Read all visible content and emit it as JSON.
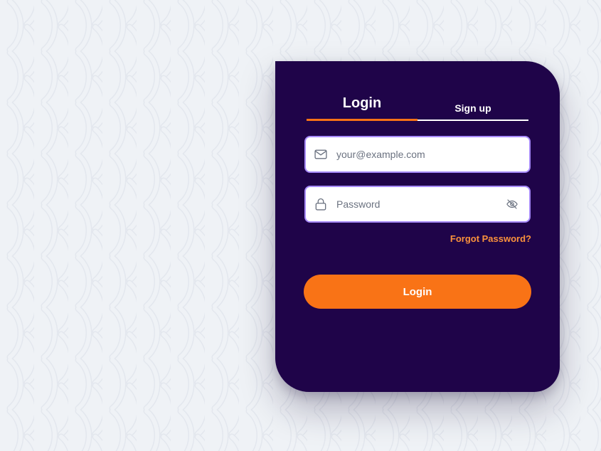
{
  "tabs": {
    "login_label": "Login",
    "signup_label": "Sign up",
    "active": "login"
  },
  "form": {
    "email": {
      "placeholder": "your@example.com",
      "value": "",
      "icon": "mail-icon"
    },
    "password": {
      "placeholder": "Password",
      "value": "",
      "icon": "lock-icon",
      "toggle_icon": "eye-off-icon"
    },
    "forgot_label": "Forgot Password?",
    "submit_label": "Login"
  },
  "colors": {
    "background": "#eff2f6",
    "card": "#1f0449",
    "accent": "#f97316",
    "forgot_link": "#fb923c",
    "field_border": "#a78bfa"
  }
}
